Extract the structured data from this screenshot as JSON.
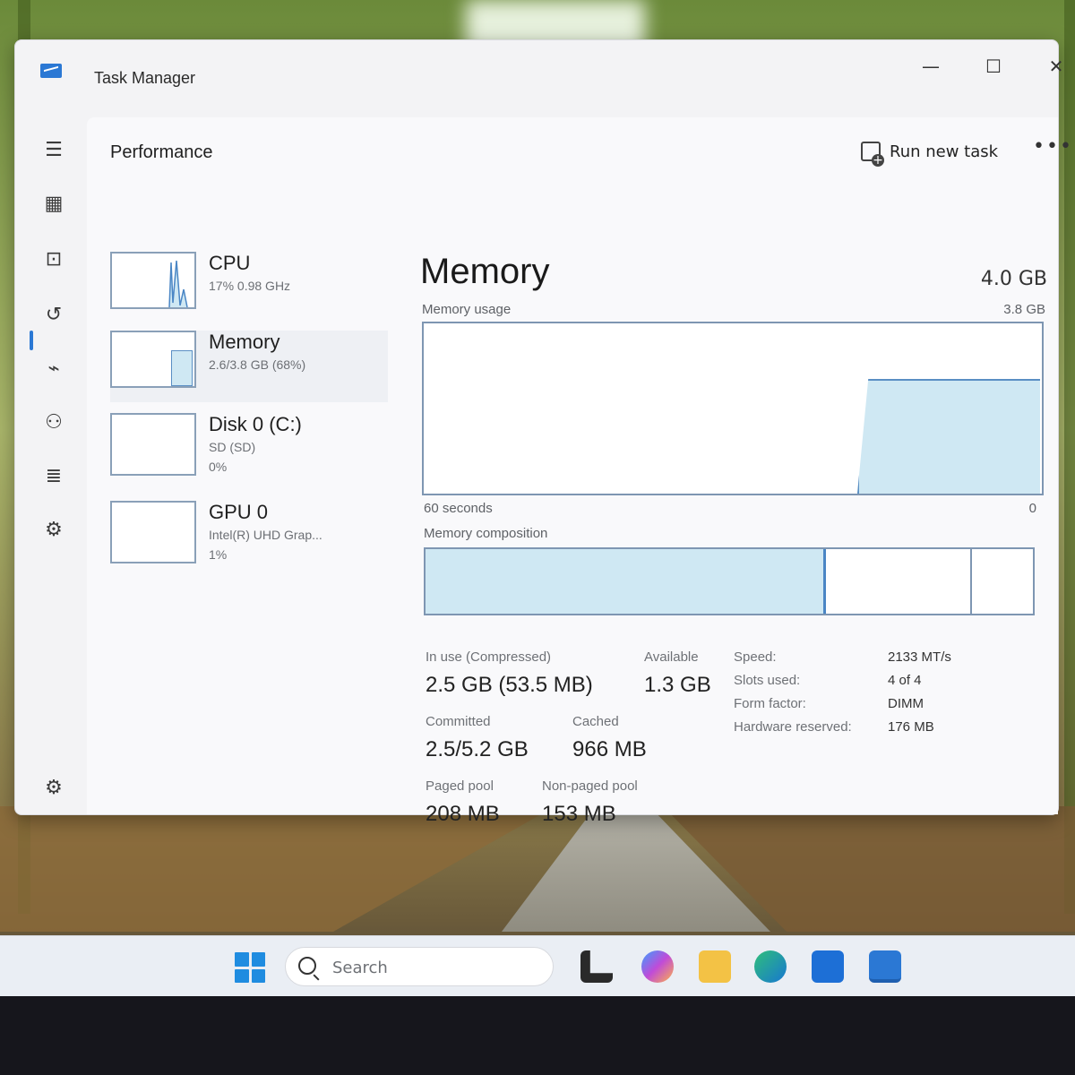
{
  "window": {
    "title": "Task Manager",
    "controls": {
      "minimize": "—",
      "maximize": "☐",
      "close": "✕"
    }
  },
  "nav": {
    "icons": [
      "hamburger-icon",
      "processes-icon",
      "performance-icon",
      "app-history-icon",
      "startup-apps-icon",
      "users-icon",
      "details-icon",
      "services-icon",
      "settings-icon"
    ]
  },
  "header": {
    "page_title": "Performance",
    "run_new_task": "Run new task",
    "more": "•••"
  },
  "perf_list": [
    {
      "name": "CPU",
      "line1": "17% 0.98 GHz",
      "line2": ""
    },
    {
      "name": "Memory",
      "line1": "2.6/3.8 GB (68%)",
      "line2": ""
    },
    {
      "name": "Disk 0 (C:)",
      "line1": "SD (SD)",
      "line2": "0%"
    },
    {
      "name": "GPU 0",
      "line1": "Intel(R) UHD Grap...",
      "line2": "1%"
    }
  ],
  "memory": {
    "title": "Memory",
    "total": "4.0 GB",
    "usage_label": "Memory usage",
    "usage_max": "3.8 GB",
    "time_span": "60 seconds",
    "time_zero": "0",
    "composition_label": "Memory composition",
    "stats": {
      "in_use_label": "In use (Compressed)",
      "in_use_value": "2.5 GB (53.5 MB)",
      "available_label": "Available",
      "available_value": "1.3 GB",
      "committed_label": "Committed",
      "committed_value": "2.5/5.2 GB",
      "cached_label": "Cached",
      "cached_value": "966 MB",
      "paged_label": "Paged pool",
      "paged_value": "208 MB",
      "nonpaged_label": "Non-paged pool",
      "nonpaged_value": "153 MB"
    },
    "specs": [
      {
        "label": "Speed:",
        "value": "2133 MT/s"
      },
      {
        "label": "Slots used:",
        "value": "4 of 4"
      },
      {
        "label": "Form factor:",
        "value": "DIMM"
      },
      {
        "label": "Hardware reserved:",
        "value": "176 MB"
      }
    ]
  },
  "taskbar": {
    "search_placeholder": "Search",
    "apps": [
      "task-view-icon",
      "copilot-icon",
      "file-explorer-icon",
      "edge-icon",
      "store-icon",
      "task-manager-icon"
    ]
  },
  "colors": {
    "accent": "#2b78d4",
    "graph_fill": "#cfe8f3",
    "graph_border": "#7e96b2"
  }
}
